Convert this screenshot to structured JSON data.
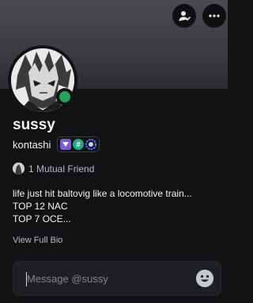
{
  "header": {
    "add_friend_icon": "person-add-icon",
    "more_icon": "more-icon"
  },
  "profile": {
    "display_name": "sussy",
    "username": "kontashi",
    "status_color": "#23a55a",
    "badges": [
      "nitro-badge",
      "hypesquad-badge",
      "quest-badge"
    ]
  },
  "mutual": {
    "text": "1 Mutual Friend"
  },
  "bio": {
    "lines": [
      "life just hit baltovig like a locomotive train...",
      "TOP 12 NAC",
      "TOP 7 OCE..."
    ],
    "view_full_label": "View Full Bio"
  },
  "message": {
    "placeholder": "Message @sussy",
    "emoji_icon": "smiley-icon"
  }
}
